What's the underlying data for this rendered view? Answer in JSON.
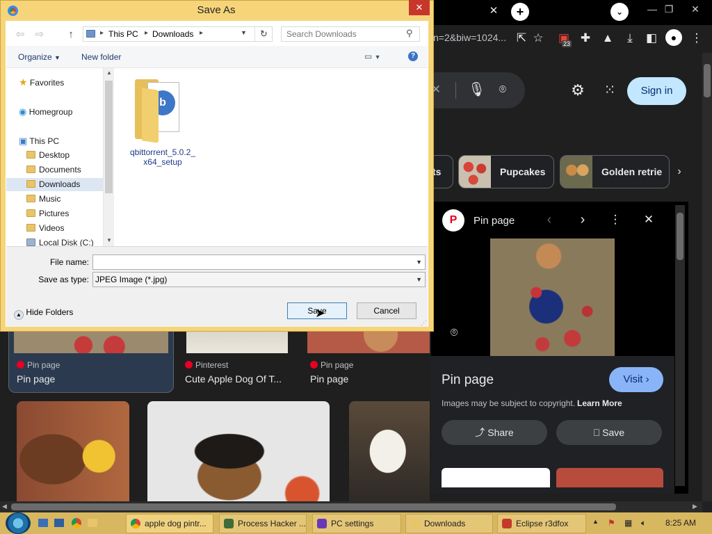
{
  "browser": {
    "address_fragment": "n=2&biw=1024...",
    "extension_badge": "23"
  },
  "google": {
    "sign_in": "Sign in",
    "chips": [
      {
        "label": "ts"
      },
      {
        "label": "Pupcakes"
      },
      {
        "label": "Golden retrie"
      }
    ]
  },
  "panel": {
    "source": "Pin page",
    "title": "Pin page",
    "visit": "Visit",
    "copyright": "Images may be subject to copyright.",
    "learn_more": "Learn More",
    "share": "Share",
    "save": "Save"
  },
  "results": [
    {
      "source": "Pin page",
      "title": "Pin page"
    },
    {
      "source": "Pinterest",
      "title": "Cute Apple Dog Of T..."
    },
    {
      "source": "Pin page",
      "title": "Pin page"
    }
  ],
  "dialog": {
    "title": "Save As",
    "breadcrumb": [
      "This PC",
      "Downloads"
    ],
    "search_placeholder": "Search Downloads",
    "organize": "Organize",
    "new_folder": "New folder",
    "nav": [
      {
        "label": "Favorites"
      },
      {
        "label": "Homegroup"
      },
      {
        "label": "This PC"
      },
      {
        "label": "Desktop"
      },
      {
        "label": "Documents"
      },
      {
        "label": "Downloads"
      },
      {
        "label": "Music"
      },
      {
        "label": "Pictures"
      },
      {
        "label": "Videos"
      },
      {
        "label": "Local Disk (C:)"
      }
    ],
    "file": {
      "name_line1": "qbittorrent_5.0.2_",
      "name_line2": "x64_setup"
    },
    "file_name_label": "File name:",
    "file_name_value": "",
    "save_type_label": "Save as type:",
    "save_type_value": "JPEG Image (*.jpg)",
    "hide_folders": "Hide Folders",
    "save_button": "Save",
    "cancel_button": "Cancel"
  },
  "taskbar": {
    "tasks": [
      {
        "label": "apple dog pintr..."
      },
      {
        "label": "Process Hacker ..."
      },
      {
        "label": "PC settings"
      },
      {
        "label": "Downloads"
      },
      {
        "label": "Eclipse r3dfox"
      }
    ],
    "time": "8:25 AM"
  }
}
